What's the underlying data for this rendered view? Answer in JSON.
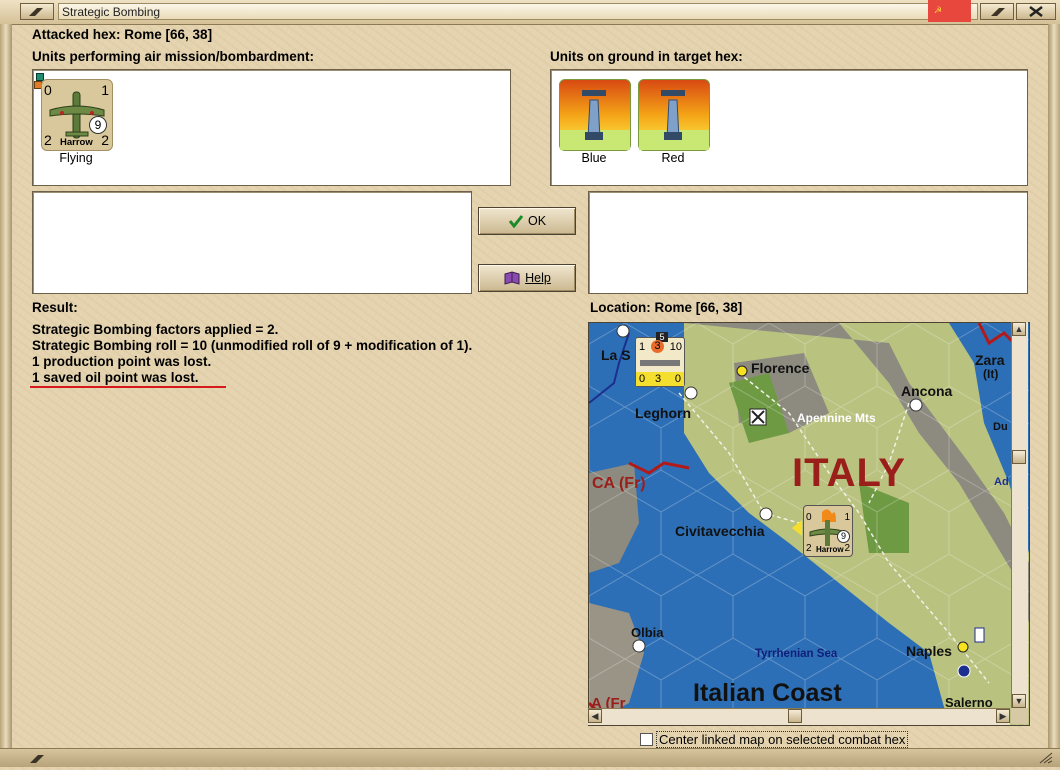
{
  "window": {
    "title": "Strategic Bombing"
  },
  "attacked_hex": "Attacked hex: Rome  [66, 38]",
  "air_units": {
    "heading": "Units performing air mission/bombardment:",
    "items": [
      {
        "label": "Flying",
        "name": "Harrow",
        "top_left": "0",
        "top_right": "1",
        "bottom_left": "2",
        "bottom_right": "2",
        "badge": "9"
      }
    ]
  },
  "ground_units": {
    "heading": "Units on ground in target hex:",
    "items": [
      {
        "label": "Blue"
      },
      {
        "label": "Red"
      }
    ]
  },
  "buttons": {
    "ok": "OK",
    "help": "Help"
  },
  "result": {
    "heading": "Result:",
    "lines": [
      "Strategic Bombing factors applied = 2.",
      "Strategic Bombing roll = 10 (unmodified roll of 9 + modification of 1).",
      "1 production point was lost.",
      "1 saved oil point was lost."
    ]
  },
  "location": "Location:  Rome  [66, 38]",
  "map": {
    "labels": {
      "la_s": "La S",
      "florence": "Florence",
      "zara": "Zara",
      "zara_it": "(It)",
      "ancona": "Ancona",
      "leghorn": "Leghorn",
      "apennine": "Apennine Mts",
      "du": "Du",
      "italy": "ITALY",
      "ca_fr": "CA (Fr)",
      "ad": "Ad",
      "civitavecchia": "Civitavecchia",
      "olbia": "Olbia",
      "tyrrhenian": "Tyrrhenian Sea",
      "naples": "Naples",
      "italian_coast": "Italian Coast",
      "salerno": "Salerno",
      "a_fr": "A (Fr"
    },
    "stack_counter": {
      "n1": "1",
      "n2": "3",
      "n3": "10",
      "b1": "0",
      "b2": "3",
      "b3": "0",
      "flag": "5"
    },
    "harrow_counter": {
      "tl": "0",
      "tr": "1",
      "bl": "2",
      "br": "2",
      "badge": "9",
      "name": "Harrow"
    }
  },
  "checkbox": {
    "label": "Center linked map on selected combat hex",
    "checked": false
  },
  "colors": {
    "water": "#2d6fb6",
    "land": "#b9c27f",
    "mountain": "#8d8a80",
    "italy_text": "#9a1f1a",
    "underline": "#d8191c"
  }
}
